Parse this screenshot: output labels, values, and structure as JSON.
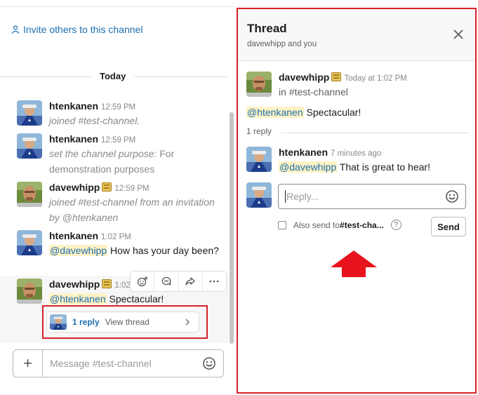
{
  "left_pane": {
    "invite_link": "Invite others to this channel",
    "day_separator": "Today",
    "messages": [
      {
        "author": "htenkanen",
        "time": "12:59 PM",
        "text": "joined #test-channel."
      },
      {
        "author": "htenkanen",
        "time": "12:59 PM",
        "text_prefix": "set the channel purpose:",
        "text_rest": " For demonstration purposes"
      },
      {
        "author": "davewhipp",
        "time": "12:59 PM",
        "text": "joined #test-channel from an invitation by @htenkanen"
      },
      {
        "author": "htenkanen",
        "time": "1:02 PM",
        "mention": "@davewhipp",
        "text": " How has your day been?"
      },
      {
        "author": "davewhipp",
        "time": "1:02 PM",
        "mention": "@htenkanen",
        "text": " Spectacular!"
      }
    ],
    "thread_summary": {
      "reply_count": "1 reply",
      "view_label": "View thread"
    },
    "composer": {
      "placeholder": "Message #test-channel"
    }
  },
  "thread_pane": {
    "title": "Thread",
    "subtitle": "davewhipp and you",
    "parent": {
      "author": "davewhipp",
      "time": "Today at 1:02 PM",
      "channel": "in #test-channel",
      "mention": "@htenkanen",
      "text": " Spectacular!"
    },
    "reply_count": "1 reply",
    "reply": {
      "author": "htenkanen",
      "time": "7 minutes ago",
      "mention": "@davewhipp",
      "text": " That is great to hear!"
    },
    "input": {
      "placeholder": "Reply..."
    },
    "also_send": {
      "prefix": "Also send to ",
      "channel": "#test-cha..."
    },
    "send_label": "Send"
  },
  "colors": {
    "link": "#1d6fb0",
    "mention_bg": "#fdf2c4",
    "highlight_red": "#d9202a"
  },
  "icons": [
    "user-icon",
    "emoji-react-icon",
    "comment-icon",
    "share-icon",
    "more-icon",
    "chevron-right-icon",
    "plus-icon",
    "smile-icon",
    "close-icon",
    "help-icon",
    "arrow-up-icon"
  ]
}
